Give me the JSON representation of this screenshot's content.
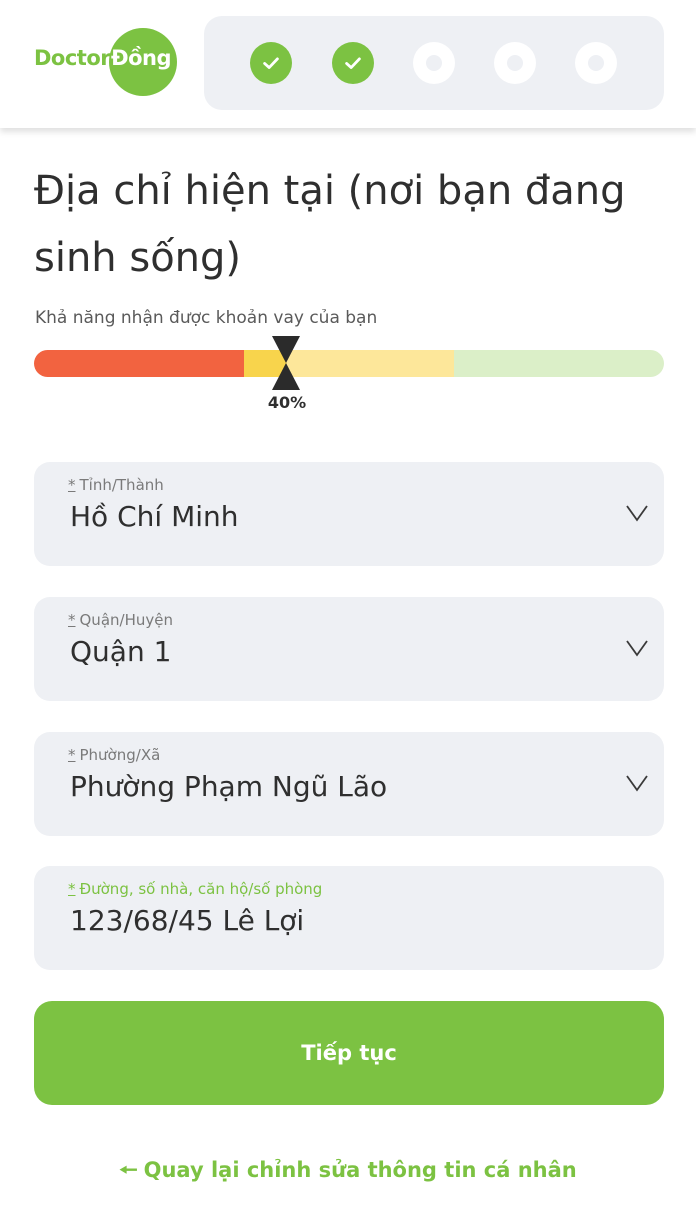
{
  "brand": {
    "name_part1": "Doctor",
    "name_part2": "Đồng",
    "color": "#7cc242"
  },
  "progress_steps": [
    {
      "state": "done",
      "icon": "check-icon"
    },
    {
      "state": "done",
      "icon": "check-icon"
    },
    {
      "state": "todo",
      "icon": "dot-icon"
    },
    {
      "state": "todo",
      "icon": "dot-icon"
    },
    {
      "state": "todo",
      "icon": "dot-icon"
    }
  ],
  "page": {
    "title": "Địa chỉ hiện tại (nơi bạn đang sinh sống)"
  },
  "loan_chance": {
    "label": "Khả năng nhận được khoản vay của bạn",
    "percent_text": "40%",
    "value": 0.4,
    "segments": [
      {
        "color": "#f26340",
        "share": 0.333
      },
      {
        "color": "#fde79a",
        "share": 0.333
      },
      {
        "color": "#dbefc8",
        "share": 0.334
      }
    ],
    "active_highlight_color": "#f8d44c"
  },
  "form": {
    "required_mark": "*",
    "province": {
      "label": "Tỉnh/Thành",
      "value": "Hồ Chí Minh"
    },
    "district": {
      "label": "Quận/Huyện",
      "value": "Quận 1"
    },
    "ward": {
      "label": "Phường/Xã",
      "value": "Phường Phạm Ngũ Lão"
    },
    "street": {
      "label": "Đường, số nhà, căn hộ/số phòng",
      "value": "123/68/45 Lê Lợi"
    }
  },
  "actions": {
    "continue_label": "Tiếp tục",
    "back_label": "Quay lại chỉnh sửa thông tin cá nhân",
    "back_icon": "arrow-left-icon"
  }
}
